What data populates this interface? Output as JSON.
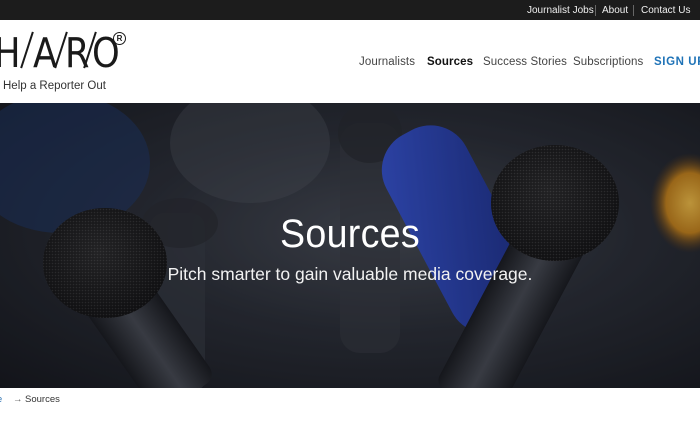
{
  "topbar": {
    "links": [
      "Journalist Jobs",
      "About",
      "Contact Us"
    ]
  },
  "logo": {
    "letters": [
      "H",
      "A",
      "R",
      "O"
    ],
    "registered": "R",
    "tagline": "Help a Reporter Out"
  },
  "nav": {
    "items": [
      {
        "label": "Journalists"
      },
      {
        "label": "Sources",
        "active": true
      },
      {
        "label": "Success Stories"
      },
      {
        "label": "Subscriptions"
      },
      {
        "label": "SIGN UP"
      }
    ]
  },
  "hero": {
    "title": "Sources",
    "subtitle": "Pitch smarter to gain valuable media coverage."
  },
  "breadcrumb": {
    "home": "me",
    "separator": "→",
    "current": "Sources"
  },
  "colors": {
    "topbar_bg": "#1c1c1c",
    "signup_link": "#1f73b7",
    "mic_blue": "#2748c8"
  }
}
